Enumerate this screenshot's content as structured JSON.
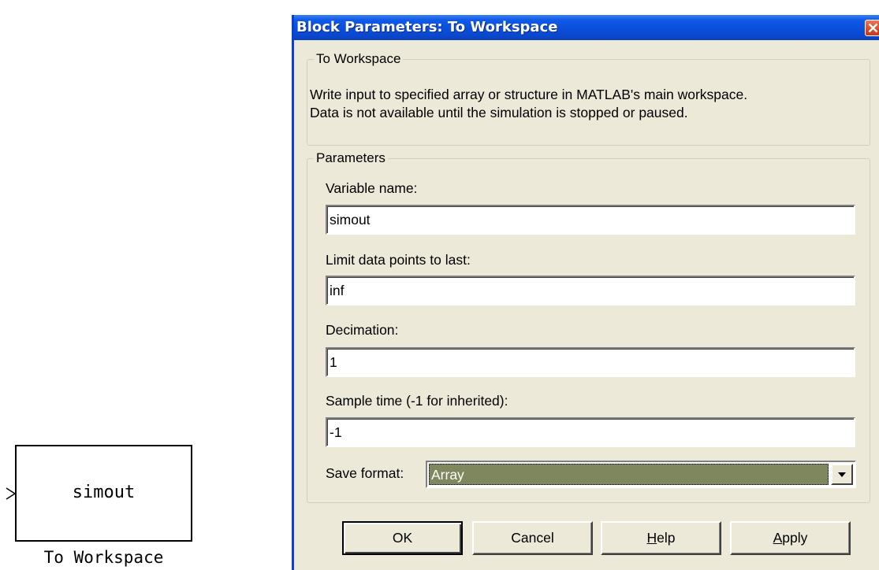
{
  "simulink_block": {
    "label": "simout",
    "name": "To Workspace"
  },
  "dialog": {
    "title": "Block Parameters: To Workspace",
    "block_group_title": "To Workspace",
    "description_line1": "Write input to specified array or structure in MATLAB's main workspace.",
    "description_line2": "Data is not available until the simulation is stopped or paused.",
    "parameters_group_title": "Parameters",
    "fields": {
      "variable_name": {
        "label": "Variable name:",
        "value": "simout"
      },
      "limit_data_points": {
        "label": "Limit data points to last:",
        "value": "inf"
      },
      "decimation": {
        "label": "Decimation:",
        "value": "1"
      },
      "sample_time": {
        "label": "Sample time (-1 for inherited):",
        "value": "-1"
      }
    },
    "save_format": {
      "label": "Save format:",
      "selected": "Array"
    },
    "buttons": {
      "ok": "OK",
      "cancel": "Cancel",
      "help_accel": "H",
      "help_rest": "elp",
      "apply_accel": "A",
      "apply_rest": "pply"
    }
  },
  "colors": {
    "titlebar": "#0a4fdc",
    "dialog_bg": "#ece9d8",
    "select_highlight": "#7f875f",
    "close_button": "#d9492a"
  }
}
